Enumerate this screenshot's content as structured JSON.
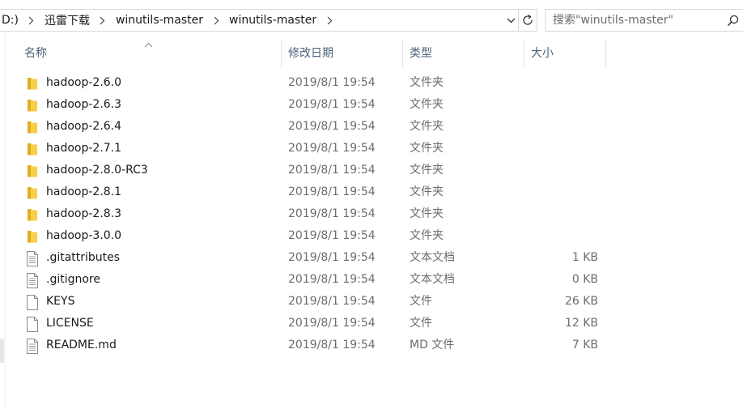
{
  "address": {
    "crumbs": [
      "D:)",
      "迅雷下载",
      "winutils-master",
      "winutils-master"
    ]
  },
  "search": {
    "placeholder": "搜索\"winutils-master\""
  },
  "columns": {
    "name": "名称",
    "date": "修改日期",
    "type": "类型",
    "size": "大小"
  },
  "files": [
    {
      "name": "hadoop-2.6.0",
      "date": "2019/8/1 19:54",
      "type": "文件夹",
      "size": "",
      "icon": "folder-icon"
    },
    {
      "name": "hadoop-2.6.3",
      "date": "2019/8/1 19:54",
      "type": "文件夹",
      "size": "",
      "icon": "folder-icon"
    },
    {
      "name": "hadoop-2.6.4",
      "date": "2019/8/1 19:54",
      "type": "文件夹",
      "size": "",
      "icon": "folder-icon"
    },
    {
      "name": "hadoop-2.7.1",
      "date": "2019/8/1 19:54",
      "type": "文件夹",
      "size": "",
      "icon": "folder-icon"
    },
    {
      "name": "hadoop-2.8.0-RC3",
      "date": "2019/8/1 19:54",
      "type": "文件夹",
      "size": "",
      "icon": "folder-icon"
    },
    {
      "name": "hadoop-2.8.1",
      "date": "2019/8/1 19:54",
      "type": "文件夹",
      "size": "",
      "icon": "folder-icon"
    },
    {
      "name": "hadoop-2.8.3",
      "date": "2019/8/1 19:54",
      "type": "文件夹",
      "size": "",
      "icon": "folder-icon"
    },
    {
      "name": "hadoop-3.0.0",
      "date": "2019/8/1 19:54",
      "type": "文件夹",
      "size": "",
      "icon": "folder-icon"
    },
    {
      "name": ".gitattributes",
      "date": "2019/8/1 19:54",
      "type": "文本文档",
      "size": "1 KB",
      "icon": "text-file-icon"
    },
    {
      "name": ".gitignore",
      "date": "2019/8/1 19:54",
      "type": "文本文档",
      "size": "0 KB",
      "icon": "text-file-icon"
    },
    {
      "name": "KEYS",
      "date": "2019/8/1 19:54",
      "type": "文件",
      "size": "26 KB",
      "icon": "blank-file-icon"
    },
    {
      "name": "LICENSE",
      "date": "2019/8/1 19:54",
      "type": "文件",
      "size": "12 KB",
      "icon": "blank-file-icon"
    },
    {
      "name": "README.md",
      "date": "2019/8/1 19:54",
      "type": "MD 文件",
      "size": "7 KB",
      "icon": "text-file-icon"
    }
  ],
  "colors": {
    "folder": "#f7cf4a",
    "folder_dark": "#e0ad22",
    "header_text": "#4c607a",
    "muted_text": "#6d6d6d"
  }
}
